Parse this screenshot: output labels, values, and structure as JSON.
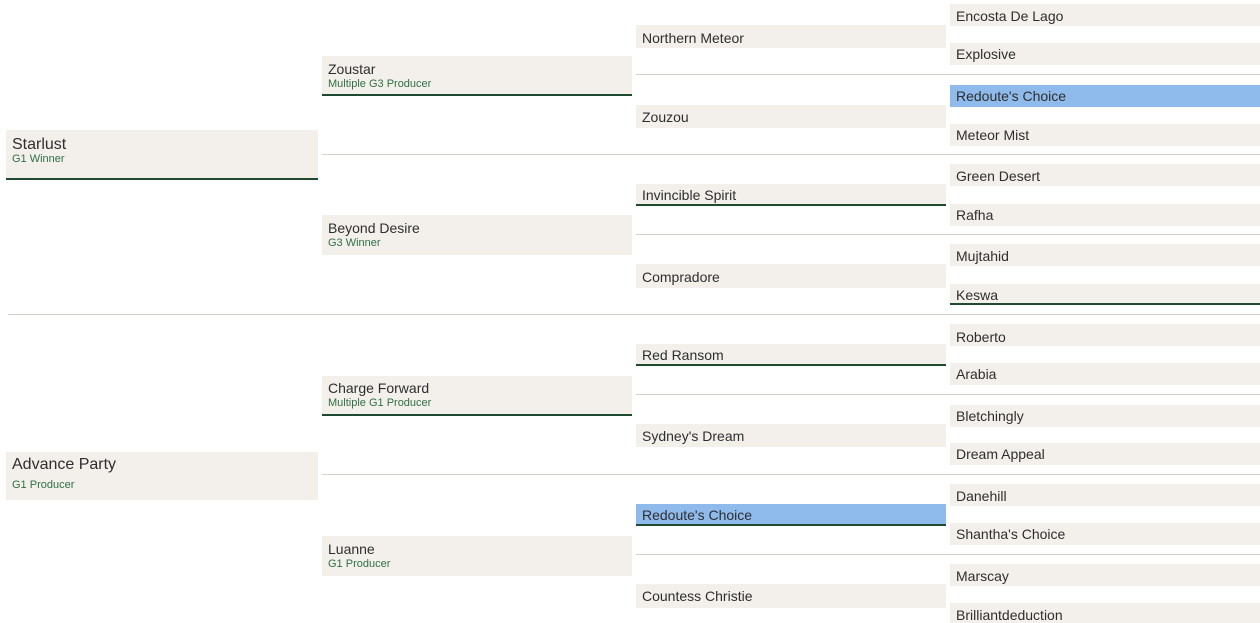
{
  "pedigree": {
    "gen1": [
      {
        "name": "Starlust",
        "note": "G1 Winner"
      },
      {
        "name": "Advance Party",
        "note": "G1 Producer"
      }
    ],
    "gen2": [
      {
        "name": "Zoustar",
        "note": "Multiple G3 Producer"
      },
      {
        "name": "Beyond Desire",
        "note": "G3 Winner"
      },
      {
        "name": "Charge Forward",
        "note": "Multiple G1 Producer"
      },
      {
        "name": "Luanne",
        "note": "G1 Producer"
      }
    ],
    "gen3": [
      {
        "name": "Northern Meteor"
      },
      {
        "name": "Zouzou"
      },
      {
        "name": "Invincible Spirit"
      },
      {
        "name": "Compradore"
      },
      {
        "name": "Red Ransom"
      },
      {
        "name": "Sydney's Dream"
      },
      {
        "name": "Redoute's Choice",
        "highlight": true
      },
      {
        "name": "Countess Christie"
      }
    ],
    "gen4": [
      {
        "name": "Encosta De Lago"
      },
      {
        "name": "Explosive"
      },
      {
        "name": "Redoute's Choice",
        "highlight": true
      },
      {
        "name": "Meteor Mist"
      },
      {
        "name": "Green Desert"
      },
      {
        "name": "Rafha"
      },
      {
        "name": "Mujtahid"
      },
      {
        "name": "Keswa"
      },
      {
        "name": "Roberto"
      },
      {
        "name": "Arabia"
      },
      {
        "name": "Bletchingly"
      },
      {
        "name": "Dream Appeal"
      },
      {
        "name": "Danehill"
      },
      {
        "name": "Shantha's Choice"
      },
      {
        "name": "Marscay"
      },
      {
        "name": "Brilliantdeduction"
      }
    ]
  },
  "colors": {
    "cell_bg": "#f3f0ec",
    "highlight_bg": "#8fbaec",
    "accent_green": "#2f6f45",
    "underline": "#1f4a31"
  }
}
